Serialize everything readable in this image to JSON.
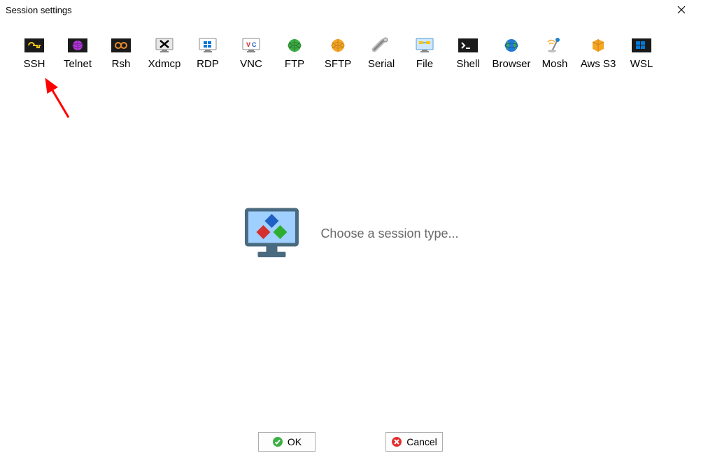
{
  "window": {
    "title": "Session settings"
  },
  "sessions": [
    {
      "id": "ssh",
      "label": "SSH"
    },
    {
      "id": "telnet",
      "label": "Telnet"
    },
    {
      "id": "rsh",
      "label": "Rsh"
    },
    {
      "id": "xdmcp",
      "label": "Xdmcp"
    },
    {
      "id": "rdp",
      "label": "RDP"
    },
    {
      "id": "vnc",
      "label": "VNC"
    },
    {
      "id": "ftp",
      "label": "FTP"
    },
    {
      "id": "sftp",
      "label": "SFTP"
    },
    {
      "id": "serial",
      "label": "Serial"
    },
    {
      "id": "file",
      "label": "File"
    },
    {
      "id": "shell",
      "label": "Shell"
    },
    {
      "id": "browser",
      "label": "Browser"
    },
    {
      "id": "mosh",
      "label": "Mosh"
    },
    {
      "id": "awss3",
      "label": "Aws S3"
    },
    {
      "id": "wsl",
      "label": "WSL"
    }
  ],
  "main": {
    "prompt": "Choose a session type..."
  },
  "footer": {
    "ok": "OK",
    "cancel": "Cancel"
  }
}
